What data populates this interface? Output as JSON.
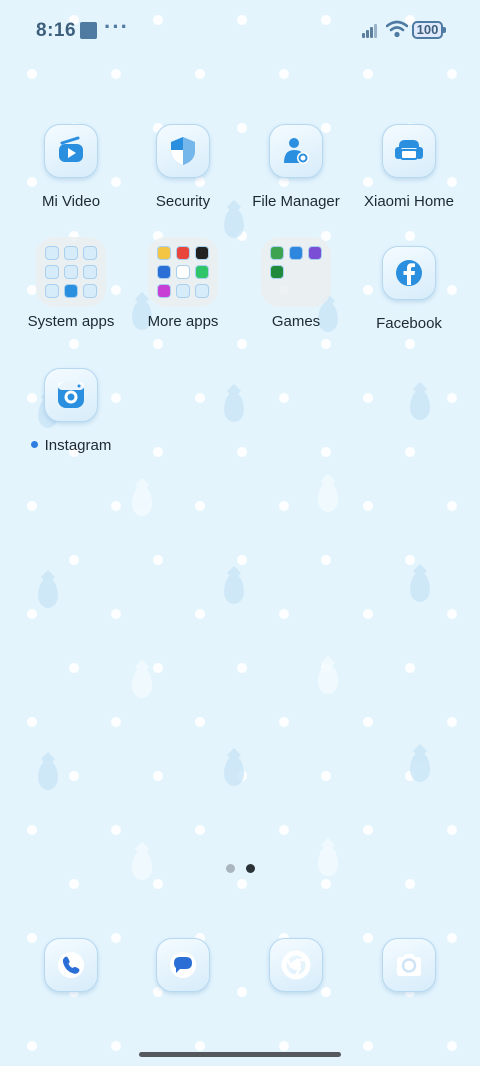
{
  "status_bar": {
    "time": "8:16",
    "more": "···",
    "battery": "100"
  },
  "apps": [
    {
      "label": "Mi Video",
      "icon": "video-icon"
    },
    {
      "label": "Security",
      "icon": "shield-icon"
    },
    {
      "label": "File Manager",
      "icon": "file-manager-icon"
    },
    {
      "label": "Xiaomi Home",
      "icon": "sofa-icon"
    },
    {
      "label": "Facebook",
      "icon": "facebook-icon"
    },
    {
      "label": "Instagram",
      "icon": "camera-icon",
      "new_indicator": true
    }
  ],
  "folders": [
    {
      "label": "System apps",
      "count": 9
    },
    {
      "label": "More apps",
      "count": 9
    },
    {
      "label": "Games",
      "count": 4
    }
  ],
  "page_indicator": {
    "pages": 2,
    "current": 2
  },
  "dock": [
    {
      "app": "phone",
      "icon": "phone-icon"
    },
    {
      "app": "messages",
      "icon": "messages-icon"
    },
    {
      "app": "chrome",
      "icon": "chrome-icon"
    },
    {
      "app": "camera",
      "icon": "camera-icon"
    }
  ],
  "colors": {
    "accent": "#2f7de1",
    "icon_glyph": "#2b8fe0",
    "background": "#e3f4fd"
  }
}
